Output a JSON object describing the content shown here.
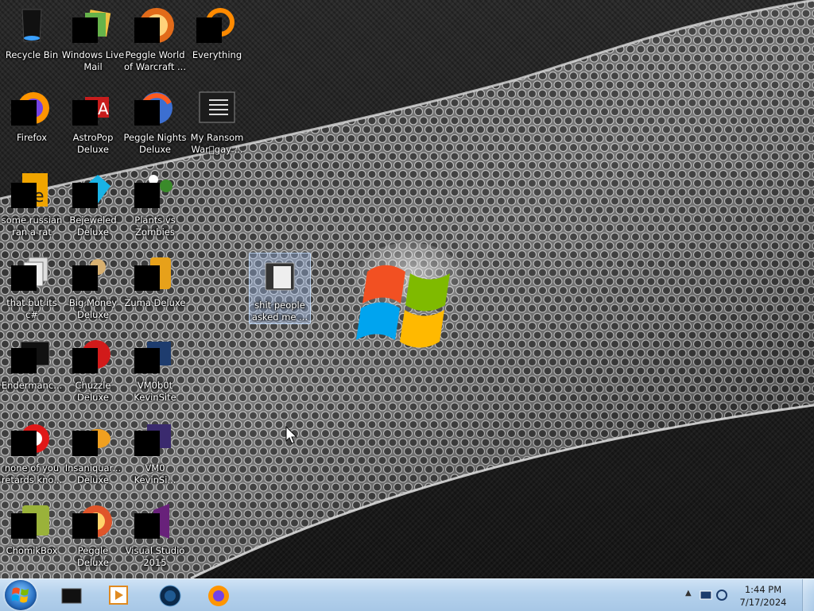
{
  "desktop": {
    "icons": [
      {
        "label": "Recycle Bin",
        "icon": "recycle-bin-icon"
      },
      {
        "label": "Windows Live Mail",
        "icon": "windows-live-mail-icon"
      },
      {
        "label": "Peggle World of Warcraft ...",
        "icon": "peggle-wow-icon"
      },
      {
        "label": "Everything",
        "icon": "everything-search-icon"
      },
      {
        "label": "Firefox",
        "icon": "firefox-icon"
      },
      {
        "label": "AstroPop Deluxe",
        "icon": "astropop-icon"
      },
      {
        "label": "Peggle Nights Deluxe",
        "icon": "peggle-nights-icon"
      },
      {
        "label": "My Ransom War\u0000gay ...",
        "icon": "shortcut-window-icon"
      },
      {
        "label": "some russian ran a rat",
        "icon": "java-file-icon"
      },
      {
        "label": "Bejeweled Deluxe",
        "icon": "bejeweled-icon"
      },
      {
        "label": "Plants vs Zombies",
        "icon": "plants-vs-zombies-icon"
      },
      {
        "label": "that but its c#",
        "icon": "document-stack-icon"
      },
      {
        "label": "Big Money Deluxe",
        "icon": "big-money-icon"
      },
      {
        "label": "Zuma Deluxe",
        "icon": "zuma-icon"
      },
      {
        "label": "shit people asked me ...",
        "icon": "folder-icon"
      },
      {
        "label": "Endermanc...",
        "icon": "console-window-icon"
      },
      {
        "label": "Chuzzle Deluxe",
        "icon": "chuzzle-icon"
      },
      {
        "label": "VM0b0t KevinSite",
        "icon": "vm-shortcut-icon"
      },
      {
        "label": "none of you retards kno...",
        "icon": "opera-like-icon"
      },
      {
        "label": "Insaniquar... Deluxe",
        "icon": "insaniquarium-icon"
      },
      {
        "label": "VM0 KevinSi...",
        "icon": "vm-shortcut-icon"
      },
      {
        "label": "ChomikBox",
        "icon": "chomikbox-icon"
      },
      {
        "label": "Peggle Deluxe",
        "icon": "peggle-icon"
      },
      {
        "label": "Visual Studio 2015",
        "icon": "visual-studio-icon"
      }
    ],
    "wallpaper": "windows-7-hexagon-mesh-wallpaper"
  },
  "taskbar": {
    "pinned": [
      {
        "name": "explorer-pinned-icon"
      },
      {
        "name": "media-player-pinned-icon"
      },
      {
        "name": "internet-globe-pinned-icon"
      },
      {
        "name": "firefox-pinned-icon"
      }
    ],
    "clock": {
      "time": "1:44 PM",
      "date": "7/17/2024"
    }
  },
  "colors": {
    "taskbar": "#b4d1ec",
    "mesh": "#9a9a9a",
    "selection": "#aac8ff"
  }
}
